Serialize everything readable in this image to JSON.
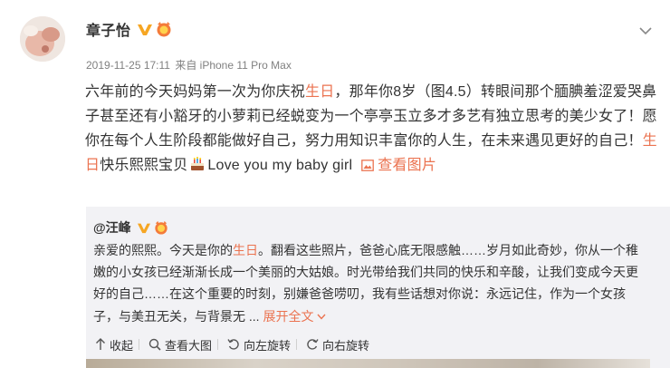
{
  "post": {
    "username": "章子怡",
    "meta": {
      "datetime": "2019-11-25 17:11",
      "via": "来自 iPhone 11 Pro Max"
    },
    "content": {
      "p1": "六年前的今天妈妈第一次为你庆祝",
      "hl1": "生日",
      "p2": "，那年你8岁（图4.5）转眼间那个腼腆羞涩爱哭鼻子甚至还有小豁牙的小萝莉已经蜕变为一个亭亭玉立多才多艺有独立思考的美少女了！愿你在每个人生阶段都能做好自己，努力用知识丰富你的人生，在未来遇见更好的自己！",
      "hl2": "生日",
      "p3": "快乐熙熙宝贝",
      "p4": "Love you my baby girl",
      "view_image": "查看图片"
    }
  },
  "repost": {
    "username": "@汪峰",
    "text": {
      "p1": "亲爱的熙熙。今天是你的",
      "hl": "生日",
      "p2": "。翻看这些照片，爸爸心底无限感触……岁月如此奇妙，你从一个稚嫩的小女孩已经渐渐长成一个美丽的大姑娘。时光带给我们共同的快乐和辛酸，让我们变成今天更好的自己……在这个重要的时刻，别嫌爸爸唠叨，我有些话想对你说：永远记住，作为一个女孩子，与美丑无关，与背景无",
      "ellipsis": " ... ",
      "expand": "展开全文"
    },
    "toolbar": {
      "collapse": "收起",
      "view_large": "查看大图",
      "rotate_left": "向左旋转",
      "rotate_right": "向右旋转"
    }
  },
  "colors": {
    "accent": "#eb7350",
    "verified": "#f6a623",
    "repost_bg": "#f2f2f5"
  }
}
